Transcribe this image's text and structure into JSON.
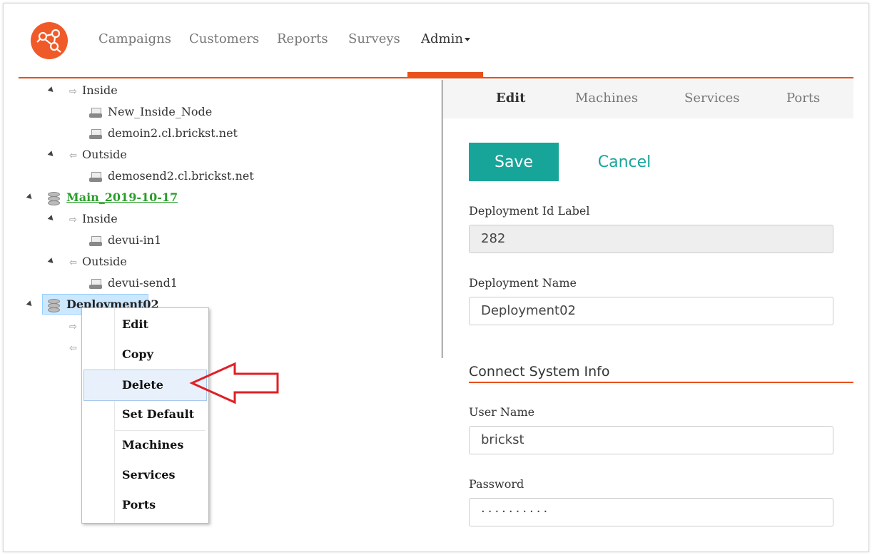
{
  "header": {
    "logo": "brickst-logo-icon",
    "nav": [
      {
        "label": "Campaigns"
      },
      {
        "label": "Customers"
      },
      {
        "label": "Reports"
      },
      {
        "label": "Surveys"
      },
      {
        "label": "Admin",
        "active": true,
        "dropdown": true
      }
    ]
  },
  "tree": {
    "rows": [
      {
        "label": "Inside",
        "icon": "arrow-right-icon"
      },
      {
        "label": "New_Inside_Node",
        "icon": "server-icon"
      },
      {
        "label": "demoin2.cl.brickst.net",
        "icon": "server-icon"
      },
      {
        "label": "Outside",
        "icon": "arrow-left-icon"
      },
      {
        "label": "demosend2.cl.brickst.net",
        "icon": "server-icon"
      },
      {
        "label": "Main_2019-10-17",
        "icon": "database-icon",
        "is_default": true
      },
      {
        "label": "Inside",
        "icon": "arrow-right-icon"
      },
      {
        "label": "devui-in1",
        "icon": "server-icon"
      },
      {
        "label": "Outside",
        "icon": "arrow-left-icon"
      },
      {
        "label": "devui-send1",
        "icon": "server-icon"
      },
      {
        "label": "Deployment02",
        "icon": "database-icon",
        "selected": true
      }
    ]
  },
  "context_menu": {
    "items": [
      {
        "label": "Edit"
      },
      {
        "label": "Copy"
      },
      {
        "label": "Delete",
        "highlighted": true
      },
      {
        "label": "Set Default"
      },
      {
        "label": "Machines"
      },
      {
        "label": "Services"
      },
      {
        "label": "Ports"
      }
    ]
  },
  "tabs": [
    {
      "label": "Edit",
      "active": true
    },
    {
      "label": "Machines"
    },
    {
      "label": "Services"
    },
    {
      "label": "Ports"
    }
  ],
  "form": {
    "save_label": "Save",
    "cancel_label": "Cancel",
    "deployment_id_label": "Deployment Id Label",
    "deployment_id_value": "282",
    "deployment_name_label": "Deployment Name",
    "deployment_name_value": "Deployment02",
    "section_title": "Connect System Info",
    "user_name_label": "User Name",
    "user_name_value": "brickst",
    "password_label": "Password",
    "password_value": "··········"
  },
  "colors": {
    "accent": "#e8501c",
    "teal": "#17a59a",
    "default_link": "#2a9d2a",
    "annotation_arrow": "#e01f26"
  }
}
